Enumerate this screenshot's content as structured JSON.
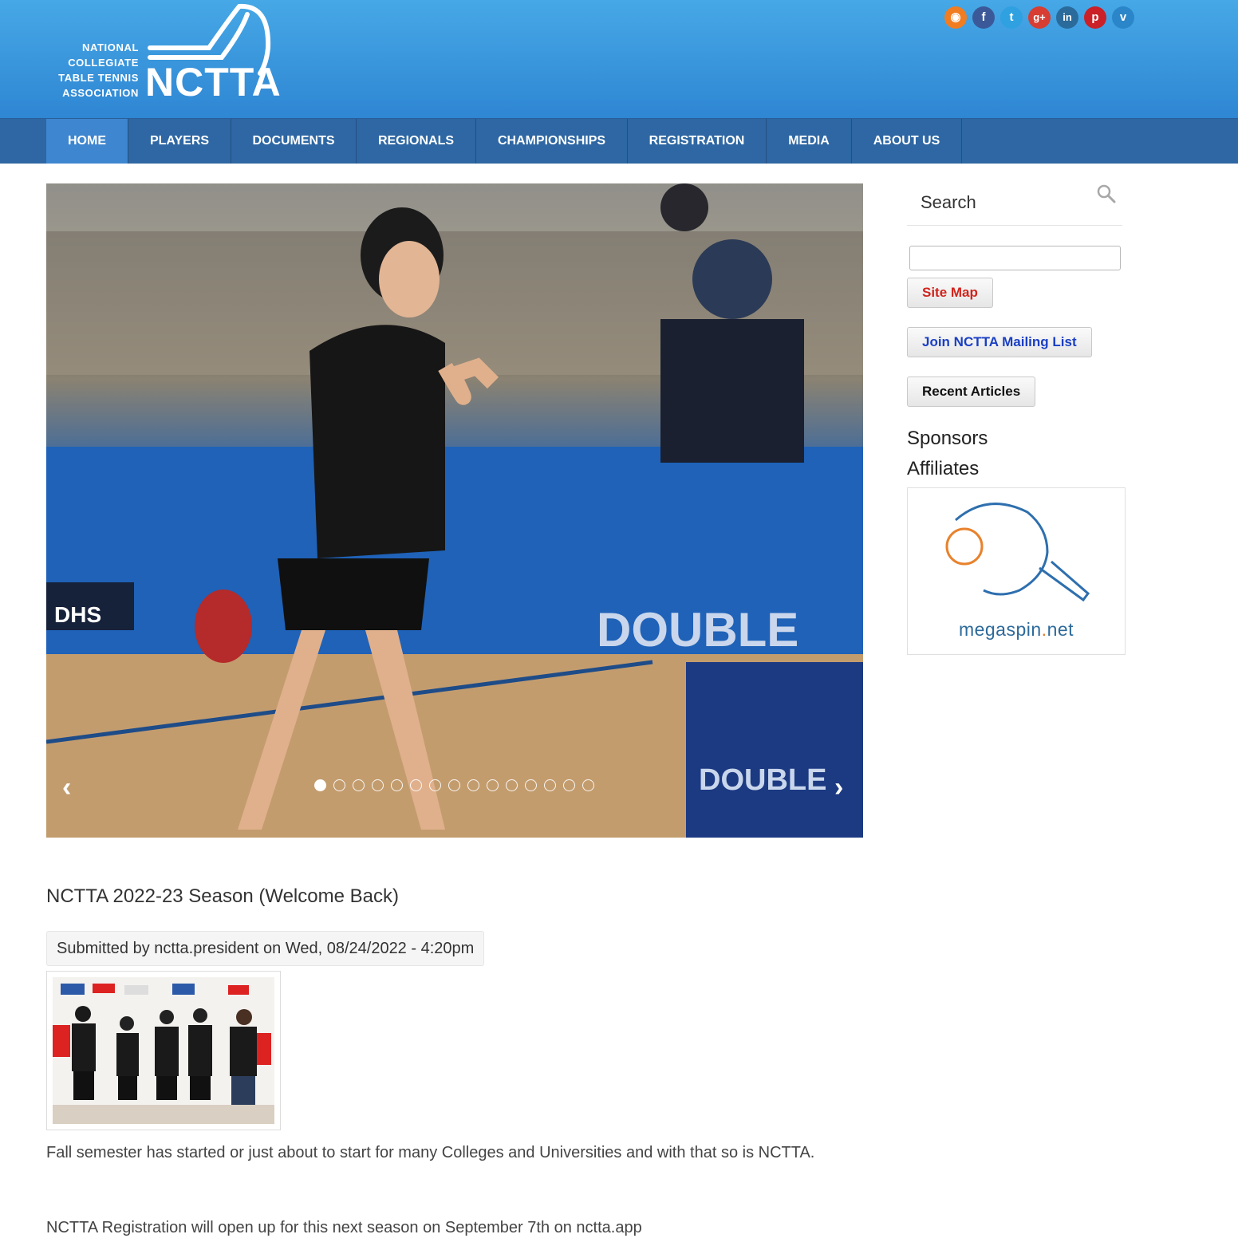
{
  "logo": {
    "text_lines": [
      "NATIONAL",
      "COLLEGIATE",
      "TABLE TENNIS",
      "ASSOCIATION"
    ],
    "wordmark": "NCTTA"
  },
  "social": [
    {
      "name": "rss",
      "glyph": "◉",
      "color": "#f07d22"
    },
    {
      "name": "facebook",
      "glyph": "f",
      "color": "#3b5998"
    },
    {
      "name": "twitter",
      "glyph": "t",
      "color": "#2fa0e0"
    },
    {
      "name": "google-plus",
      "glyph": "g+",
      "color": "#d73d32"
    },
    {
      "name": "linkedin",
      "glyph": "in",
      "color": "#2a6b9c"
    },
    {
      "name": "pinterest",
      "glyph": "p",
      "color": "#cb2027"
    },
    {
      "name": "vimeo",
      "glyph": "v",
      "color": "#2a86c8"
    }
  ],
  "nav": {
    "items": [
      "HOME",
      "PLAYERS",
      "DOCUMENTS",
      "REGIONALS",
      "CHAMPIONSHIPS",
      "REGISTRATION",
      "MEDIA",
      "ABOUT US"
    ],
    "active": "HOME"
  },
  "slider": {
    "prev": "‹",
    "next": "›",
    "slide_count": 15,
    "current_slide": 1,
    "banner_text": "DOUBLE",
    "banner_text_2": "DOUBLE",
    "table_brand": "DHS"
  },
  "article": {
    "title": "NCTTA 2022-23 Season (Welcome Back)",
    "submitted": "Submitted by nctta.president on Wed, 08/24/2022 - 4:20pm",
    "paragraphs": [
      "Fall semester has started or just about to start for many Colleges and Universities and with that so is NCTTA.",
      "NCTTA Registration will open up for this next season on September 7th on nctta.app"
    ]
  },
  "sidebar": {
    "search_label": "Search",
    "search_value": "",
    "buttons": [
      {
        "label": "Site Map",
        "color": "#d0241c"
      },
      {
        "label": "Join NCTTA Mailing List",
        "color": "#1a3fc4"
      },
      {
        "label": "Recent Articles",
        "color": "#111111"
      }
    ],
    "sponsors_heading": "Sponsors",
    "affiliates_heading": "Affiliates",
    "affiliate": {
      "name_main": "megaspin",
      "name_dot": ".",
      "name_tld": "net"
    }
  }
}
